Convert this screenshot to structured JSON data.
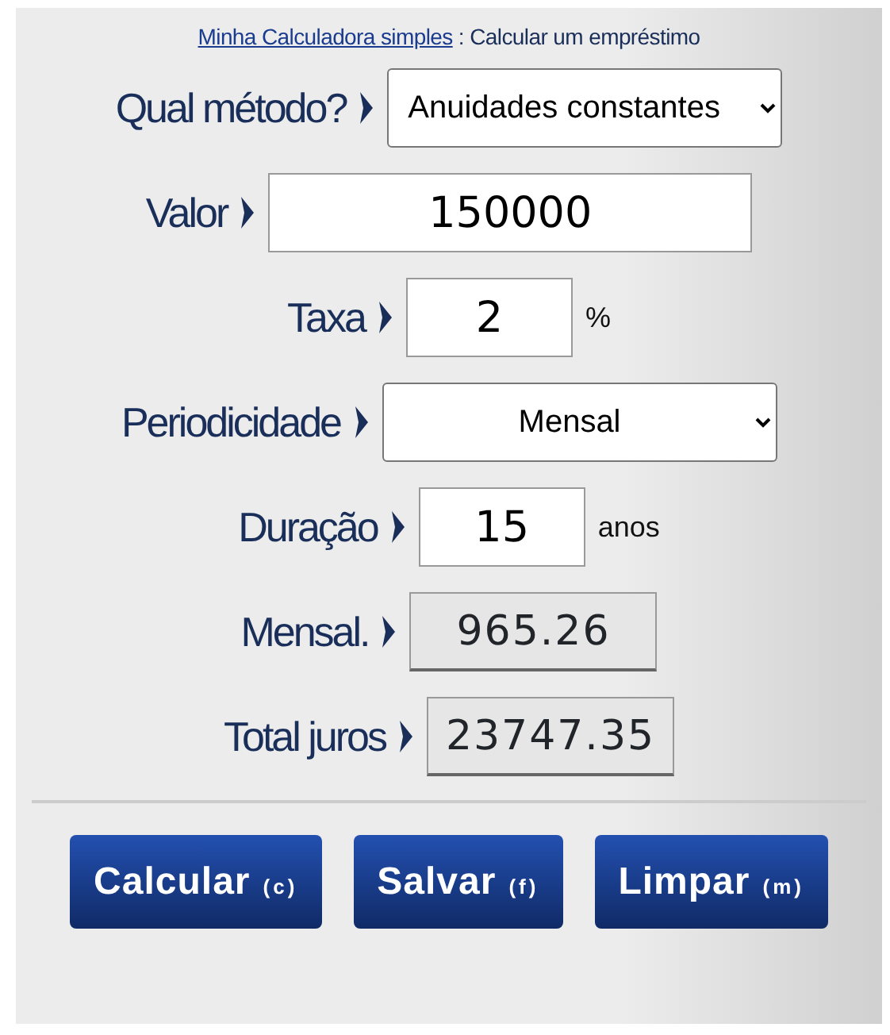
{
  "header": {
    "link": "Minha Calculadora simples",
    "separator": ":",
    "title": "Calcular um empréstimo"
  },
  "fields": [
    {
      "kind": "select",
      "label": "Qual método?",
      "value": "Anuidades constantes"
    },
    {
      "kind": "input",
      "label": "Valor",
      "value": "150000"
    },
    {
      "kind": "input",
      "label": "Taxa",
      "value": "2",
      "unit": "%"
    },
    {
      "kind": "select",
      "label": "Periodicidade",
      "value": "Mensal"
    },
    {
      "kind": "input",
      "label": "Duração",
      "value": "15",
      "unit": "anos"
    },
    {
      "kind": "output",
      "label": "Mensal.",
      "value": "965.26"
    },
    {
      "kind": "output",
      "label": "Total juros",
      "value": "23747.35"
    }
  ],
  "buttons": [
    {
      "label": "Calcular",
      "shortcut": "(c)"
    },
    {
      "label": "Salvar",
      "shortcut": "(f)"
    },
    {
      "label": "Limpar",
      "shortcut": "(m)"
    }
  ]
}
